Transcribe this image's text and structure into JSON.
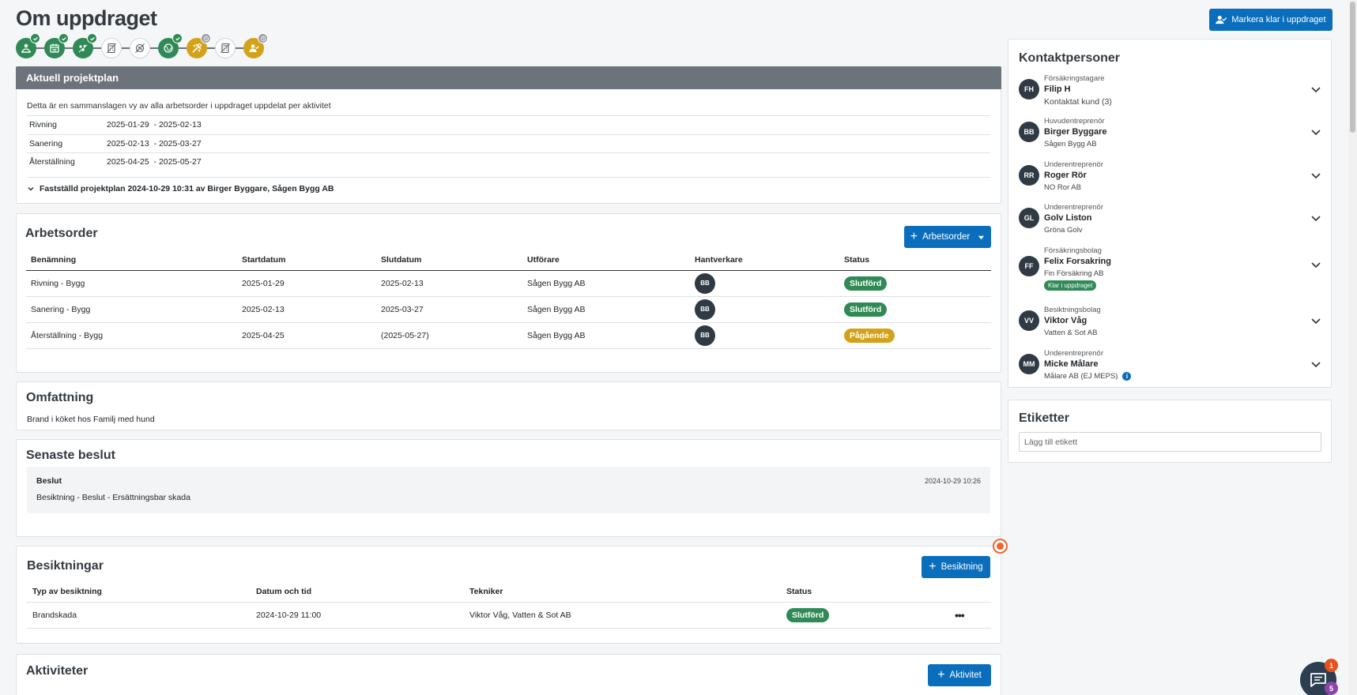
{
  "page": {
    "title": "Om uppdraget",
    "mark_ready_label": "Markera klar i uppdraget"
  },
  "colors": {
    "primary": "#0a6ebd",
    "success": "#2f8a55",
    "warning": "#d4a21a",
    "dark": "#2f3a44"
  },
  "steps": [
    {
      "icon": "person-hand-icon",
      "state": "done"
    },
    {
      "icon": "calendar-icon",
      "state": "done"
    },
    {
      "icon": "mold-icon",
      "state": "done"
    },
    {
      "icon": "calculator-icon",
      "state": "inactive"
    },
    {
      "icon": "no-mold-icon",
      "state": "inactive"
    },
    {
      "icon": "globe-icon",
      "state": "done"
    },
    {
      "icon": "tools-icon",
      "state": "pending"
    },
    {
      "icon": "calculator-icon",
      "state": "inactive"
    },
    {
      "icon": "person-check-icon",
      "state": "pending"
    }
  ],
  "project_plan": {
    "header": "Aktuell projektplan",
    "description": "Detta är en sammanslagen vy av alla arbetsorder i uppdraget uppdelat per aktivitet",
    "rows": [
      {
        "label": "Rivning",
        "dates": "2025-01-29  - 2025-02-13"
      },
      {
        "label": "Sanering",
        "dates": "2025-02-13  - 2025-03-27"
      },
      {
        "label": "Återställning",
        "dates": "2025-04-25  - 2025-05-27"
      }
    ],
    "summary": "Fastställd projektplan 2024-10-29 10:31 av Birger Byggare, Sågen Bygg AB"
  },
  "work_orders": {
    "title": "Arbetsorder",
    "button": "Arbetsorder",
    "columns": [
      "Benämning",
      "Startdatum",
      "Slutdatum",
      "Utförare",
      "Hantverkare",
      "Status"
    ],
    "rows": [
      {
        "name": "Rivning - Bygg",
        "start": "2025-01-29",
        "end": "2025-02-13",
        "performer": "Sågen Bygg AB",
        "worker": "BB",
        "status": "Slutförd"
      },
      {
        "name": "Sanering - Bygg",
        "start": "2025-02-13",
        "end": "2025-03-27",
        "performer": "Sågen Bygg AB",
        "worker": "BB",
        "status": "Slutförd"
      },
      {
        "name": "Återställning - Bygg",
        "start": "2025-04-25",
        "end": "(2025-05-27)",
        "performer": "Sågen Bygg AB",
        "worker": "BB",
        "status": "Pågående"
      }
    ]
  },
  "scope": {
    "title": "Omfattning",
    "text": "Brand i köket hos Familj med hund"
  },
  "latest_decision": {
    "title": "Senaste beslut",
    "label": "Beslut",
    "timestamp": "2024-10-29 10:26",
    "text": "Besiktning - Beslut - Ersättningsbar skada"
  },
  "inspections": {
    "title": "Besiktningar",
    "button": "Besiktning",
    "columns": [
      "Typ av besiktning",
      "Datum och tid",
      "Tekniker",
      "Status"
    ],
    "rows": [
      {
        "type": "Brandskada",
        "datetime": "2024-10-29 11:00",
        "technician": "Viktor Våg, Vatten & Sot AB",
        "status": "Slutförd",
        "menu": "•••"
      }
    ]
  },
  "activities": {
    "title": "Aktiviteter",
    "button": "Aktivitet"
  },
  "contacts": {
    "title": "Kontaktpersoner",
    "items": [
      {
        "initials": "FH",
        "role": "Försäkringstagare",
        "name": "Filip H",
        "company": "Kontaktat kund (3)"
      },
      {
        "initials": "BB",
        "role": "Huvudentreprenör",
        "name": "Birger Byggare",
        "company": "Sågen Bygg AB"
      },
      {
        "initials": "RR",
        "role": "Underentreprenör",
        "name": "Roger Rör",
        "company": "NO Ror AB"
      },
      {
        "initials": "GL",
        "role": "Underentreprenör",
        "name": "Golv Liston",
        "company": "Gröna Golv"
      },
      {
        "initials": "FF",
        "role": "Försäkringsbolag",
        "name": "Felix Forsakring",
        "company": "Fin Försäkring AB",
        "badge": "Klar i uppdraget"
      },
      {
        "initials": "VV",
        "role": "Besiktningsbolag",
        "name": "Viktor Våg",
        "company": "Vatten & Sot AB"
      },
      {
        "initials": "MM",
        "role": "Underentreprenör",
        "name": "Micke Målare",
        "company": "Målare AB (EJ MEPS)",
        "info": "i"
      }
    ]
  },
  "labels": {
    "title": "Etiketter",
    "placeholder": "Lägg till etikett"
  },
  "chat": {
    "unread": "1",
    "count": "5"
  }
}
